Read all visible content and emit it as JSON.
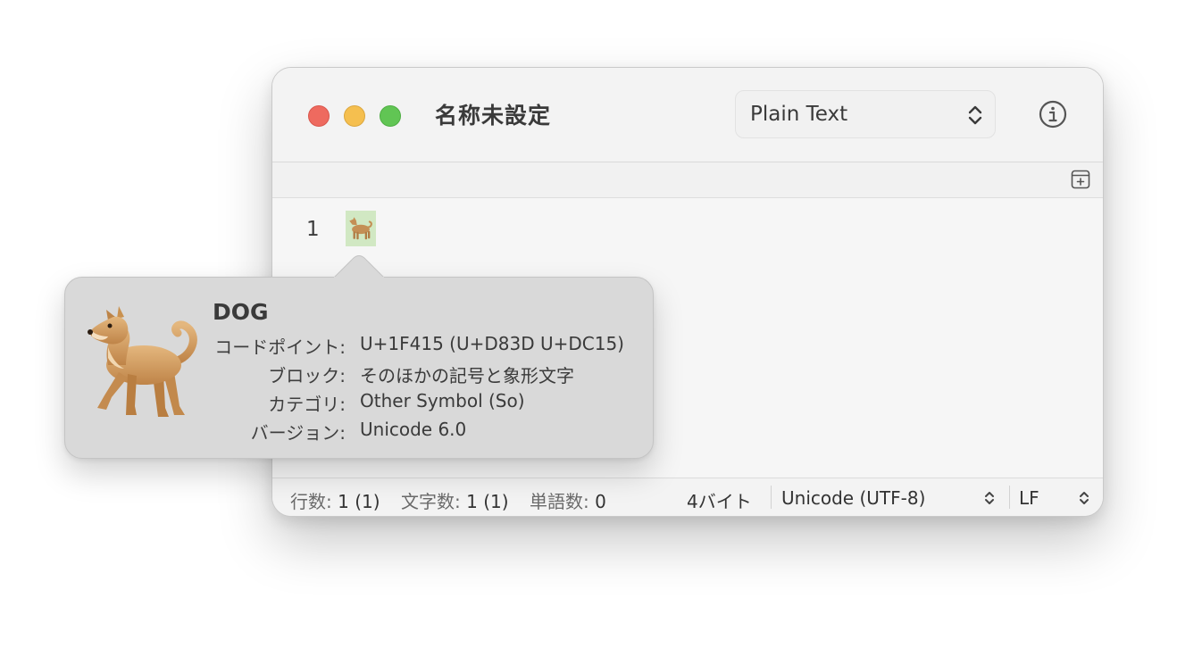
{
  "window": {
    "title": "名称未設定",
    "syntax": {
      "selected": "Plain Text"
    }
  },
  "editor": {
    "line_number": "1",
    "content_char": "🐕"
  },
  "status": {
    "lines_label": "行数:",
    "lines_value": "1 (1)",
    "chars_label": "文字数:",
    "chars_value": "1 (1)",
    "words_label": "単語数:",
    "words_value": "0",
    "bytes": "4バイト",
    "encoding": "Unicode (UTF-8)",
    "line_ending": "LF"
  },
  "popover": {
    "name": "DOG",
    "rows": [
      {
        "label": "コードポイント:",
        "value": "U+1F415 (U+D83D U+DC15)"
      },
      {
        "label": "ブロック:",
        "value": "そのほかの記号と象形文字"
      },
      {
        "label": "カテゴリ:",
        "value": "Other Symbol (So)"
      },
      {
        "label": "バージョン:",
        "value": "Unicode 6.0"
      }
    ]
  },
  "colors": {
    "close": "#ee6a5f",
    "minimize": "#f5bf4f",
    "zoom": "#61c554",
    "selection_highlight": "#d1e8c3",
    "popover_bg": "#d9d9d9"
  },
  "icons": [
    "info-icon",
    "updown-chevron-icon",
    "split-editor-icon",
    "dog-icon"
  ]
}
